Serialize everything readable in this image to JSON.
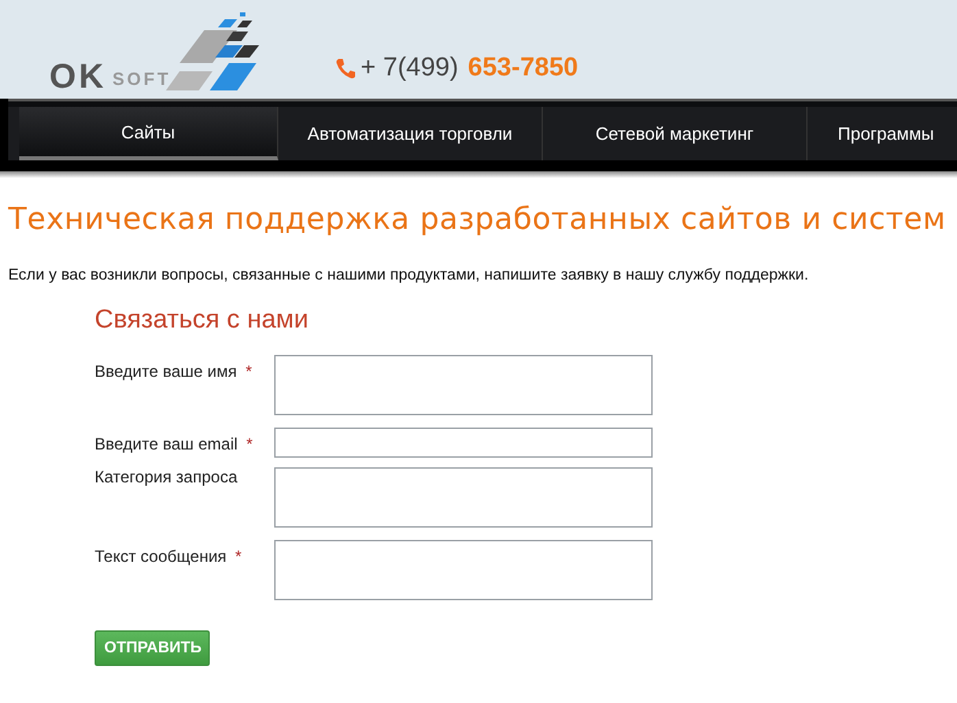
{
  "header": {
    "logo": {
      "main": "OK",
      "sub": "SOFT"
    },
    "phone": {
      "prefix": "+ 7(499)",
      "number": "653-7850"
    }
  },
  "nav": [
    {
      "label": "Сайты",
      "selected": true
    },
    {
      "label": "Автоматизация торговли",
      "selected": false
    },
    {
      "label": "Сетевой маркетинг",
      "selected": false
    },
    {
      "label": "Программы",
      "selected": false
    }
  ],
  "title": "Техническая поддержка разработанных сайтов и систем",
  "intro": "Если у вас возникли вопросы, связанные с нашими продуктами, напишите заявку в нашу службу поддержки.",
  "form": {
    "heading": "Связаться с нами",
    "required_mark": "*",
    "fields": [
      {
        "label": "Введите ваше имя",
        "required": true,
        "kind": "textarea"
      },
      {
        "label": "Введите ваш email",
        "required": true,
        "kind": "input"
      },
      {
        "label": "Категория запроса",
        "required": false,
        "kind": "textarea"
      },
      {
        "label": "Текст сообщения",
        "required": true,
        "kind": "textarea"
      }
    ],
    "submit": "ОТПРАВИТЬ"
  }
}
